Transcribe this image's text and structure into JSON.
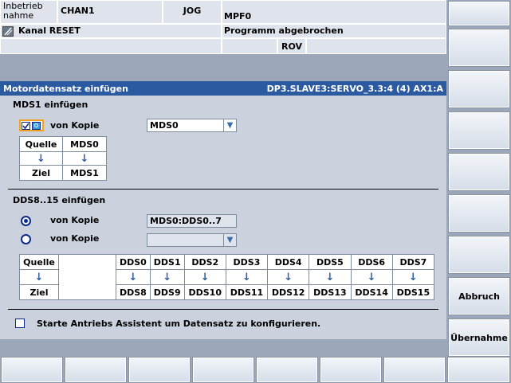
{
  "header": {
    "mode_label": "Inbetrieb\nnahme",
    "channel": "CHAN1",
    "op_mode": "JOG",
    "program": "MPF0",
    "channel_status": "Kanal RESET",
    "program_status": "Programm abgebrochen",
    "override": "ROV"
  },
  "title_bar": {
    "left": "Motordatensatz einfügen",
    "right": "DP3.SLAVE3:SERVO_3.3:4 (4) AX1:A"
  },
  "mds": {
    "heading": "MDS1 einfügen",
    "copy_label": "von Kopie",
    "dropdown_value": "MDS0",
    "quelle_label": "Quelle",
    "quelle_value": "MDS0",
    "ziel_label": "Ziel",
    "ziel_value": "MDS1"
  },
  "dds": {
    "heading": "DDS8..15 einfügen",
    "option1_label": "von Kopie",
    "option1_value": "MDS0:DDS0..7",
    "option2_label": "von Kopie",
    "option2_value": "",
    "quelle_label": "Quelle",
    "ziel_label": "Ziel",
    "sources": [
      "DDS0",
      "DDS1",
      "DDS2",
      "DDS3",
      "DDS4",
      "DDS5",
      "DDS6",
      "DDS7"
    ],
    "targets": [
      "DDS8",
      "DDS9",
      "DDS10",
      "DDS11",
      "DDS12",
      "DDS13",
      "DDS14",
      "DDS15"
    ]
  },
  "assistant": {
    "label": "Starte Antriebs Assistent um Datensatz zu konfigurieren.",
    "checked": false
  },
  "softkeys": {
    "cancel": "Abbruch",
    "accept": "Übernahme"
  },
  "colors": {
    "title_bar": "#2c5aa0",
    "background": "#cbd2de",
    "accent_orange": "#f0a020"
  }
}
